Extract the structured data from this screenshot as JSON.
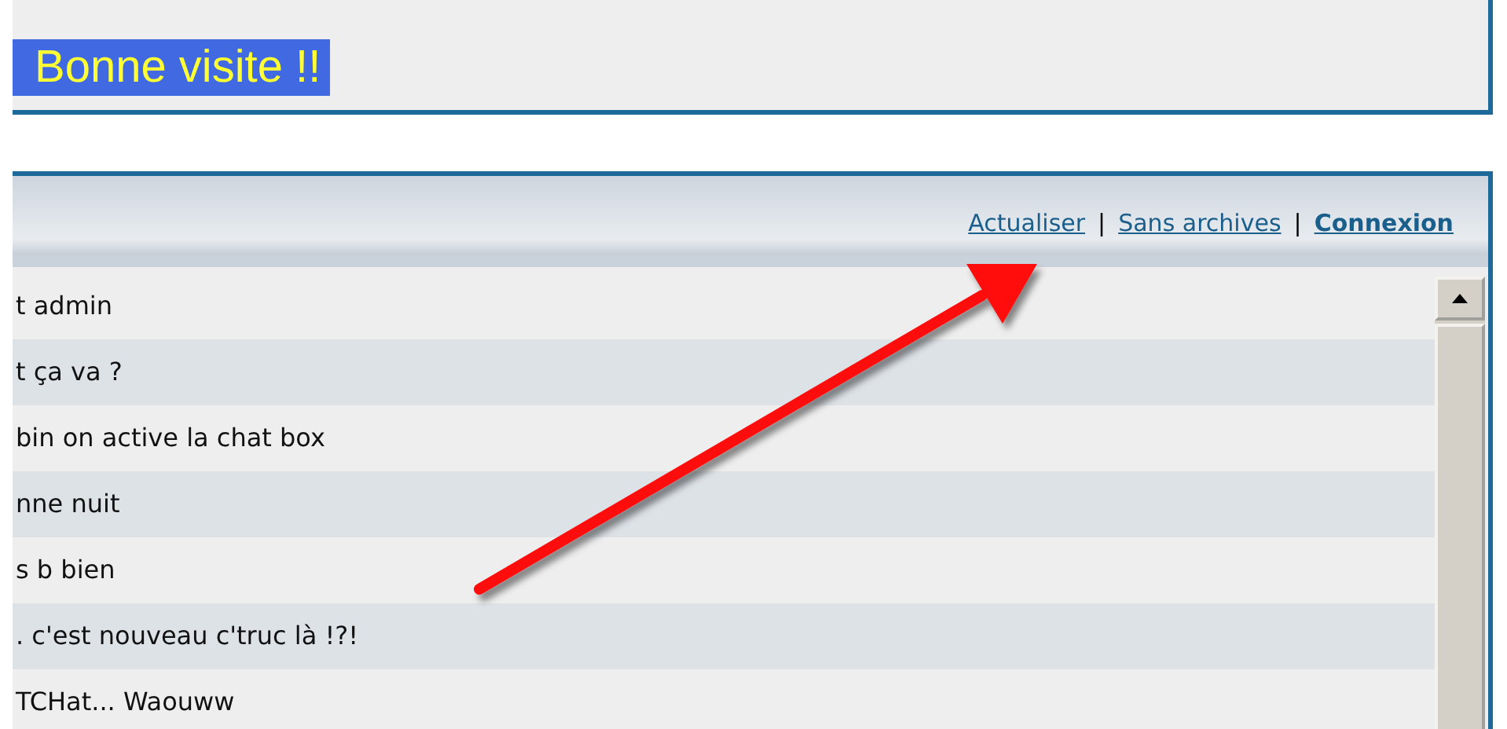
{
  "banner": {
    "greeting": "Bonne visite !!"
  },
  "chat": {
    "links": [
      {
        "label": "Actualiser",
        "bold": false
      },
      {
        "label": "Sans archives",
        "bold": false
      },
      {
        "label": "Connexion",
        "bold": true
      }
    ],
    "separator": "|",
    "messages": [
      "t admin",
      "t ça va ?",
      "bin on active la chat box",
      "nne nuit",
      "s b bien",
      ". c'est nouveau c'truc là !?!",
      "TCHat... Waouww"
    ]
  }
}
